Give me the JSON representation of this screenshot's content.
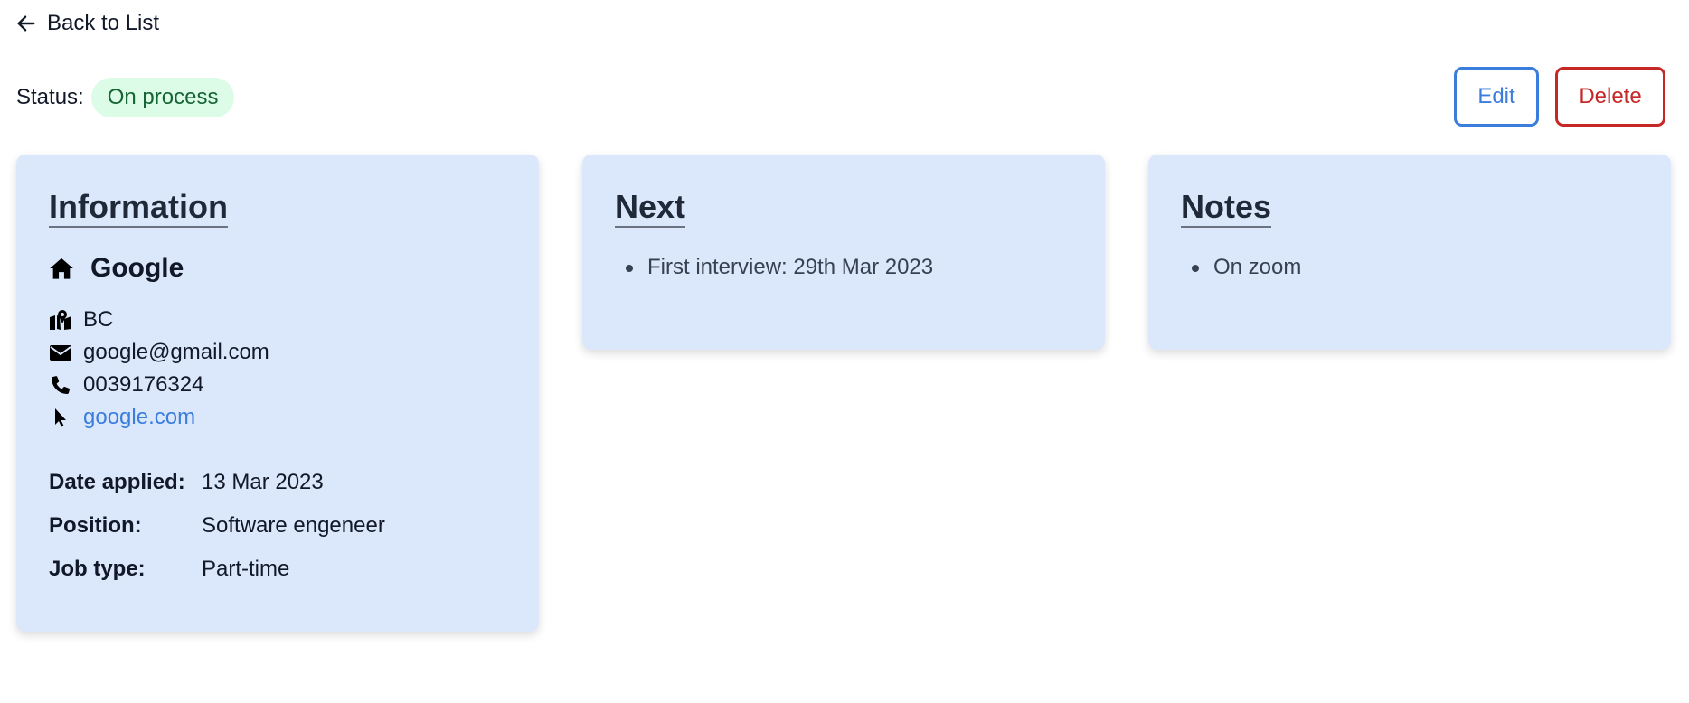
{
  "nav": {
    "back_label": "Back to List"
  },
  "status": {
    "label": "Status:",
    "value": "On process"
  },
  "actions": {
    "edit_label": "Edit",
    "delete_label": "Delete"
  },
  "information": {
    "title": "Information",
    "company": "Google",
    "location": "BC",
    "email": "google@gmail.com",
    "phone": "0039176324",
    "website": "google.com",
    "details": [
      {
        "label": "Date applied:",
        "value": "13 Mar 2023"
      },
      {
        "label": "Position:",
        "value": "Software engeneer"
      },
      {
        "label": "Job type:",
        "value": "Part-time"
      }
    ]
  },
  "next": {
    "title": "Next",
    "items": [
      "First interview: 29th Mar 2023"
    ]
  },
  "notes": {
    "title": "Notes",
    "items": [
      "On zoom"
    ]
  },
  "colors": {
    "card_bg": "#dbe8fb",
    "status_bg": "#dcfce7",
    "status_text": "#166534",
    "edit": "#3b7ddd",
    "delete": "#c62828",
    "link": "#3b7ddd"
  },
  "icons": {
    "back": "arrow-left-icon",
    "company": "home-icon",
    "location": "map-location-icon",
    "email": "envelope-icon",
    "phone": "phone-icon",
    "website": "cursor-pointer-icon"
  }
}
